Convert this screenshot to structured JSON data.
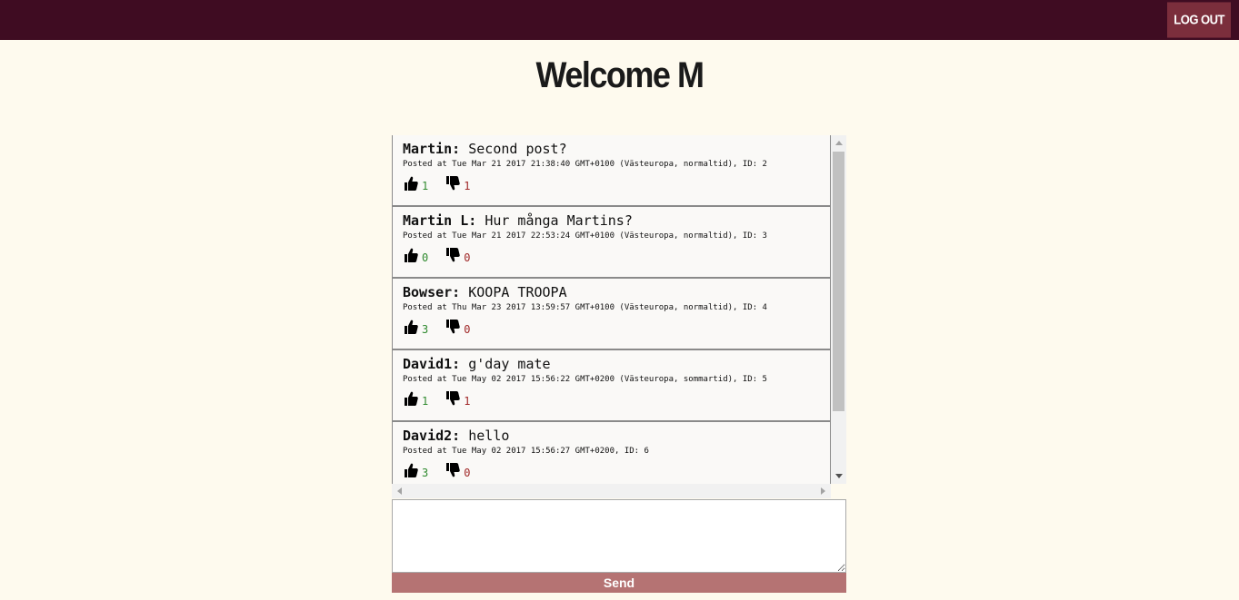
{
  "header": {
    "logout_label": "LOG OUT",
    "background": "#3f0c22",
    "button_color": "#7b2e3c"
  },
  "welcome": {
    "title": "Welcome M"
  },
  "posts": [
    {
      "author": "Martin:",
      "message": "Second post?",
      "meta": "Posted at Tue Mar 21 2017 21:38:40 GMT+0100 (Västeuropa, normaltid), ID: 2",
      "likes": "1",
      "dislikes": "1"
    },
    {
      "author": "Martin L:",
      "message": "Hur många Martins?",
      "meta": "Posted at Tue Mar 21 2017 22:53:24 GMT+0100 (Västeuropa, normaltid), ID: 3",
      "likes": "0",
      "dislikes": "0"
    },
    {
      "author": "Bowser:",
      "message": "KOOPA TROOPA",
      "meta": "Posted at Thu Mar 23 2017 13:59:57 GMT+0100 (Västeuropa, normaltid), ID: 4",
      "likes": "3",
      "dislikes": "0"
    },
    {
      "author": "David1:",
      "message": "g'day mate",
      "meta": "Posted at Tue May 02 2017 15:56:22 GMT+0200 (Västeuropa, sommartid), ID: 5",
      "likes": "1",
      "dislikes": "1"
    },
    {
      "author": "David2:",
      "message": "hello",
      "meta": "Posted at Tue May 02 2017 15:56:27 GMT+0200, ID: 6",
      "likes": "3",
      "dislikes": "0"
    }
  ],
  "composer": {
    "value": "",
    "placeholder": ""
  },
  "send_label": "Send",
  "colors": {
    "page_background": "#fefaee",
    "send_button": "#b57373",
    "like_count": "#2f8a2f",
    "dislike_count": "#a02828"
  }
}
